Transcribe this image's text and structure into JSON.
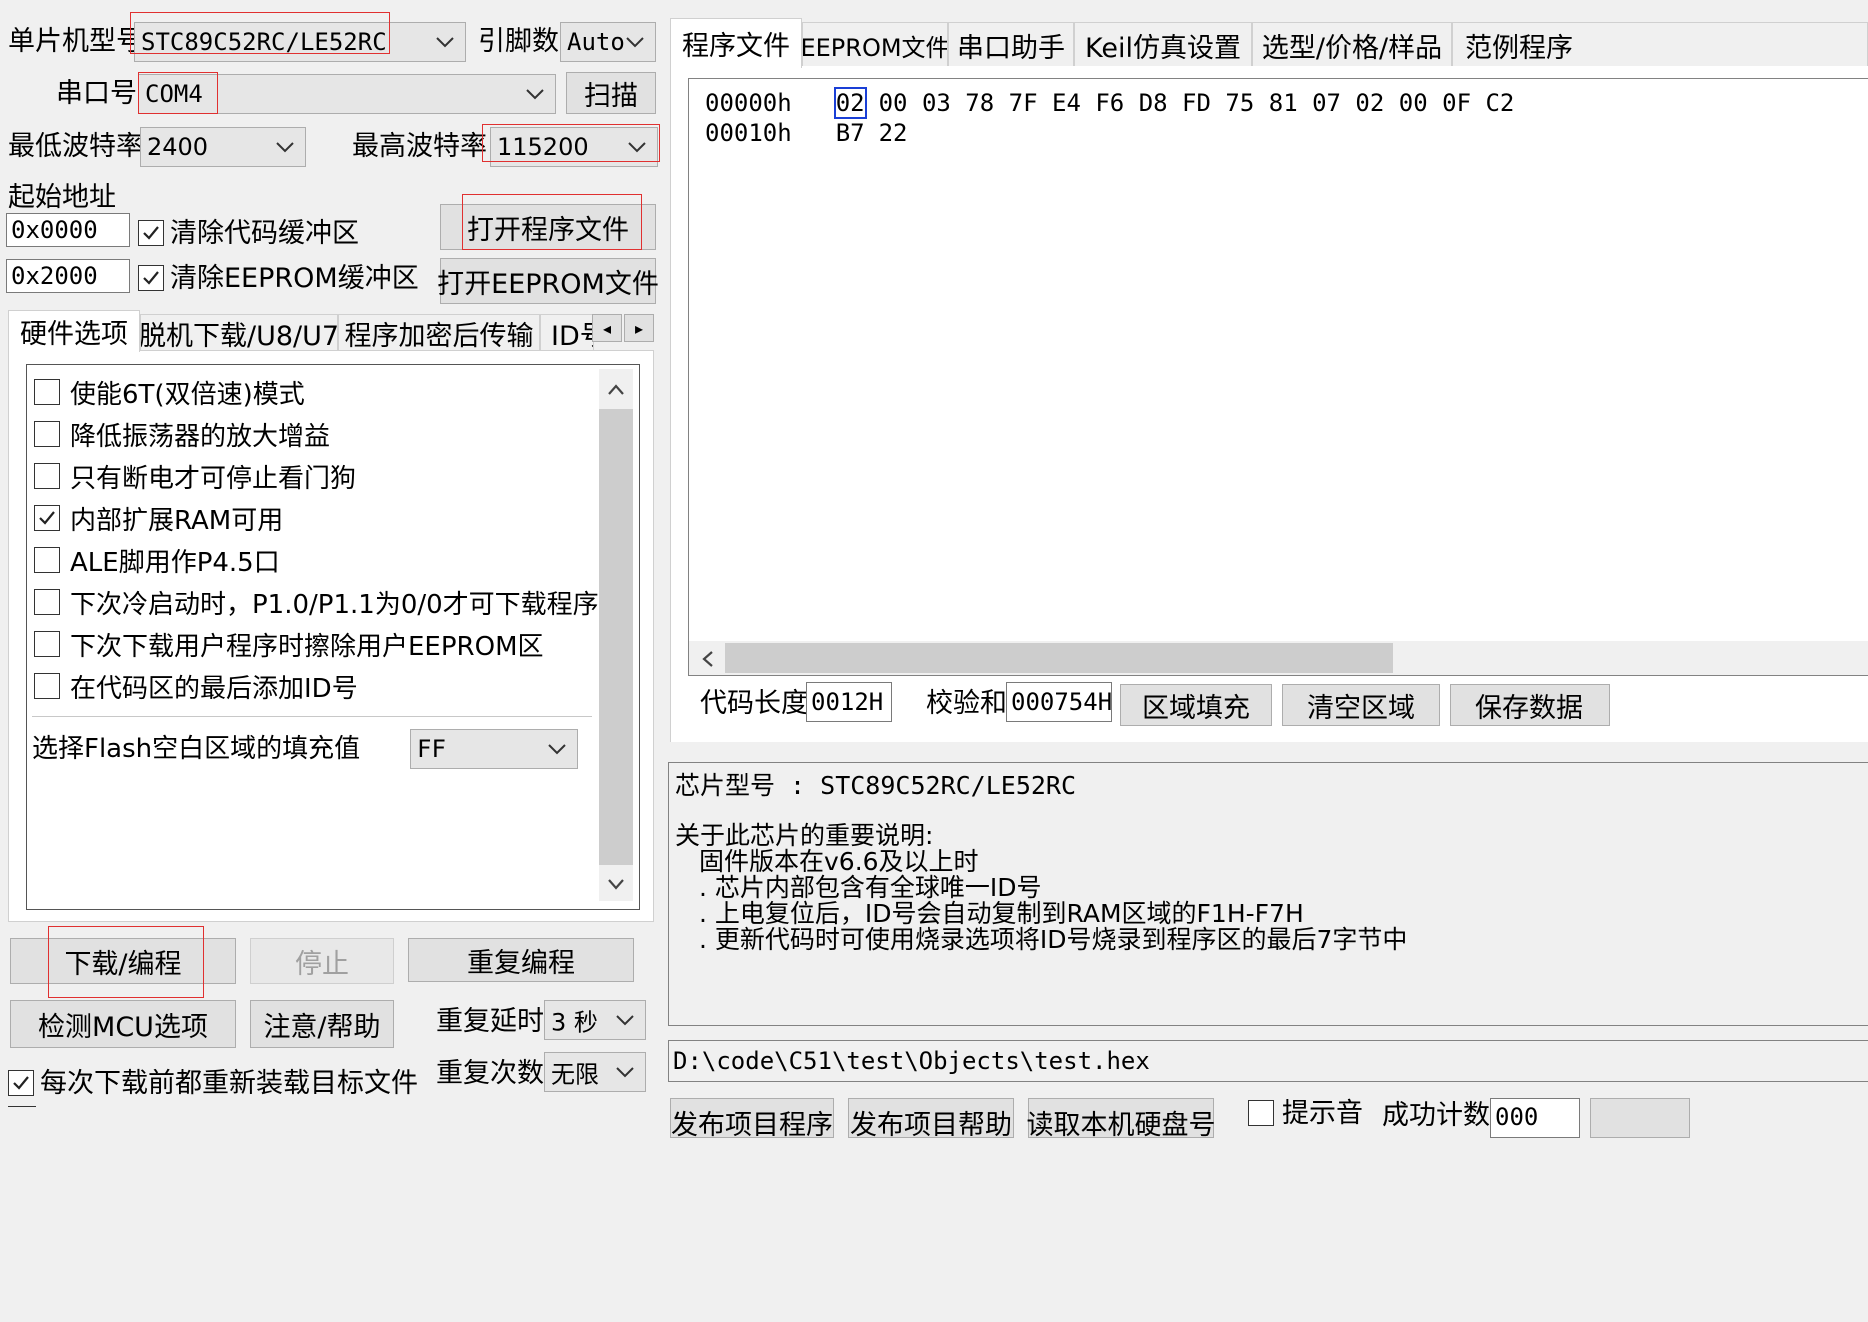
{
  "top": {
    "mcu_label": "单片机型号",
    "mcu_value": "STC89C52RC/LE52RC",
    "pins_label": "引脚数",
    "pins_value": "Auto",
    "port_label": "串口号",
    "port_value": "COM4",
    "scan_button": "扫描",
    "min_baud_label": "最低波特率",
    "min_baud_value": "2400",
    "max_baud_label": "最高波特率",
    "max_baud_value": "115200",
    "start_addr_label": "起始地址",
    "code_addr": "0x0000",
    "clear_code_label": "清除代码缓冲区",
    "clear_code_checked": true,
    "eeprom_addr": "0x2000",
    "clear_eeprom_label": "清除EEPROM缓冲区",
    "clear_eeprom_checked": true,
    "open_program_button": "打开程序文件",
    "open_eeprom_button": "打开EEPROM文件"
  },
  "left_tabs": [
    "硬件选项",
    "脱机下载/U8/U7",
    "程序加密后传输",
    "ID号"
  ],
  "hardware_options": [
    {
      "label": "使能6T(双倍速)模式",
      "checked": false
    },
    {
      "label": "降低振荡器的放大增益",
      "checked": false
    },
    {
      "label": "只有断电才可停止看门狗",
      "checked": false
    },
    {
      "label": "内部扩展RAM可用",
      "checked": true
    },
    {
      "label": "ALE脚用作P4.5口",
      "checked": false
    },
    {
      "label": "下次冷启动时，P1.0/P1.1为0/0才可下载程序",
      "checked": false
    },
    {
      "label": "下次下载用户程序时擦除用户EEPROM区",
      "checked": false
    },
    {
      "label": "在代码区的最后添加ID号",
      "checked": false
    }
  ],
  "fill_value": {
    "label": "选择Flash空白区域的填充值",
    "value": "FF"
  },
  "bottom_left": {
    "download_button": "下载/编程",
    "stop_button": "停止",
    "repeat_button": "重复编程",
    "detect_button": "检测MCU选项",
    "help_button": "注意/帮助",
    "repeat_delay_label": "重复延时",
    "repeat_delay_value": "3 秒",
    "repeat_count_label": "重复次数",
    "repeat_count_value": "无限",
    "reload_label": "每次下载前都重新装载目标文件",
    "reload_checked": true
  },
  "right_tabs": [
    "程序文件",
    "EEPROM文件",
    "串口助手",
    "Keil仿真设置",
    "选型/价格/样品",
    "范例程序"
  ],
  "hex_view": {
    "rows": [
      {
        "addr": "00000h",
        "first": "02",
        "rest": "00 03 78 7F E4 F6 D8 FD 75 81 07 02 00 0F C2"
      },
      {
        "addr": "00010h",
        "first": "B7",
        "rest": "22"
      }
    ]
  },
  "code_panel": {
    "code_len_label": "代码长度",
    "code_len_value": "0012H",
    "checksum_label": "校验和",
    "checksum_value": "000754H",
    "fill_button": "区域填充",
    "clear_button": "清空区域",
    "save_button": "保存数据"
  },
  "info": {
    "chip_line": "芯片型号 : STC89C52RC/LE52RC",
    "notes_title": "关于此芯片的重要说明:",
    "firmware_line": "固件版本在v6.6及以上时",
    "notes": [
      ". 芯片内部包含有全球唯一ID号",
      ". 上电复位后，ID号会自动复制到RAM区域的F1H-F7H",
      ". 更新代码时可使用烧录选项将ID号烧录到程序区的最后7字节中"
    ]
  },
  "file_path": "D:\\code\\C51\\test\\Objects\\test.hex",
  "bottom_right": {
    "publish_program": "发布项目程序",
    "publish_help": "发布项目帮助",
    "read_id": "读取本机硬盘号",
    "beep_label": "提示音",
    "success_count_label": "成功计数",
    "success_count_value": "000"
  },
  "colors": {
    "annotation_red": "#e03030",
    "cursor_blue": "#1a3fd6",
    "window_bg": "#f0f0f0"
  }
}
